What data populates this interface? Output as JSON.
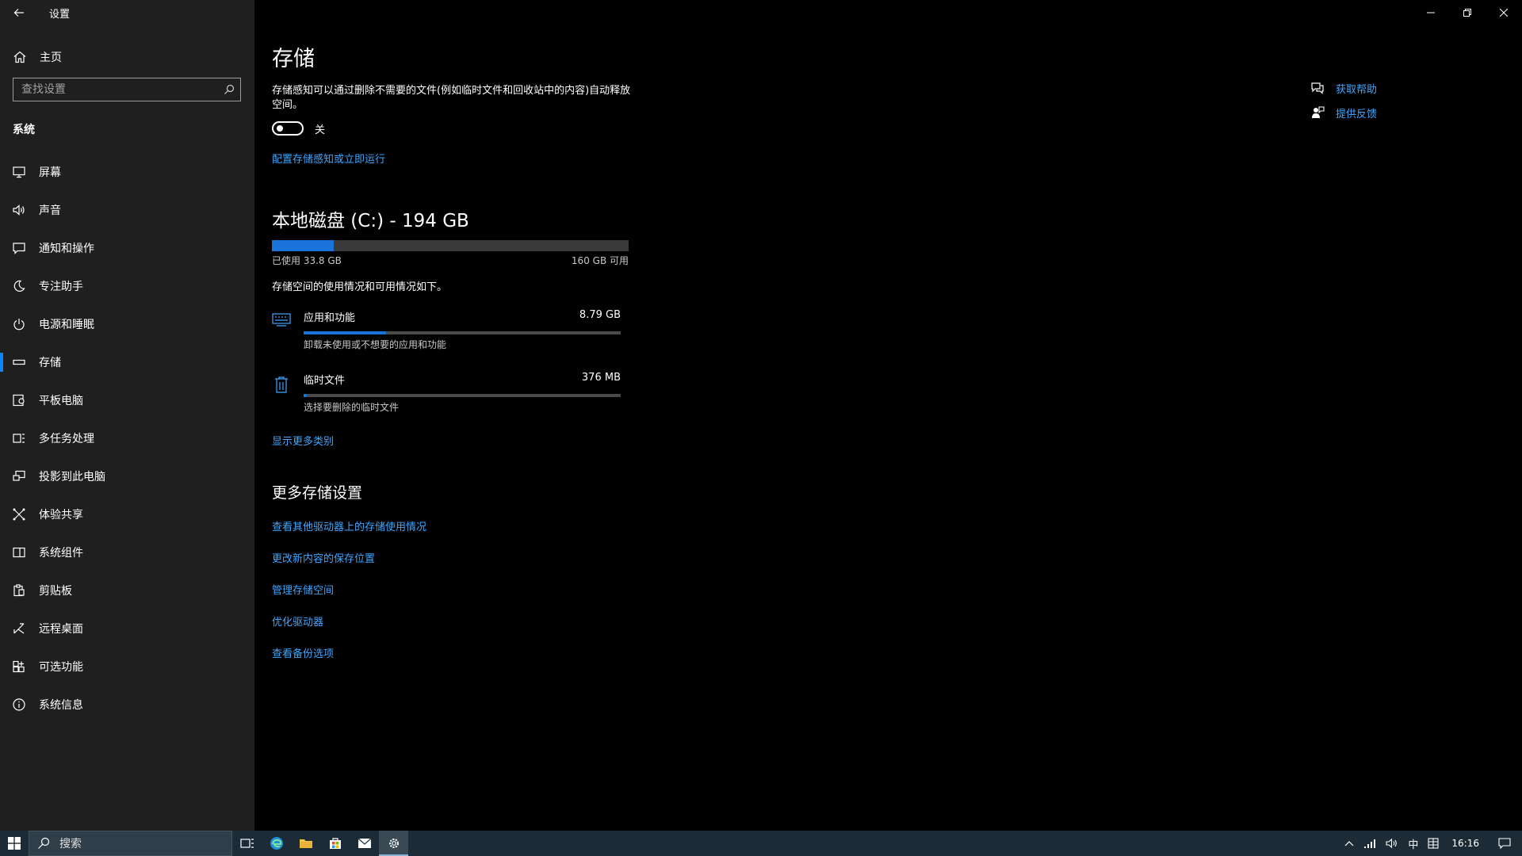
{
  "window": {
    "title": "设置"
  },
  "sidebar": {
    "home_label": "主页",
    "search_placeholder": "查找设置",
    "section_title": "系统",
    "items": [
      {
        "label": "屏幕",
        "icon": "monitor-icon"
      },
      {
        "label": "声音",
        "icon": "speaker-icon"
      },
      {
        "label": "通知和操作",
        "icon": "notification-icon"
      },
      {
        "label": "专注助手",
        "icon": "moon-icon"
      },
      {
        "label": "电源和睡眠",
        "icon": "power-icon"
      },
      {
        "label": "存储",
        "icon": "storage-icon",
        "active": true
      },
      {
        "label": "平板电脑",
        "icon": "tablet-icon"
      },
      {
        "label": "多任务处理",
        "icon": "multitask-icon"
      },
      {
        "label": "投影到此电脑",
        "icon": "project-icon"
      },
      {
        "label": "体验共享",
        "icon": "share-icon"
      },
      {
        "label": "系统组件",
        "icon": "components-icon"
      },
      {
        "label": "剪贴板",
        "icon": "clipboard-icon"
      },
      {
        "label": "远程桌面",
        "icon": "remote-icon"
      },
      {
        "label": "可选功能",
        "icon": "optional-features-icon"
      },
      {
        "label": "系统信息",
        "icon": "info-icon"
      }
    ]
  },
  "main": {
    "title": "存储",
    "description": "存储感知可以通过删除不需要的文件(例如临时文件和回收站中的内容)自动释放空间。",
    "toggle": {
      "state_label": "关",
      "on": false
    },
    "config_link": "配置存储感知或立即运行",
    "disk": {
      "title": "本地磁盘 (C:) - 194 GB",
      "used_label": "已使用 33.8 GB",
      "free_label": "160 GB 可用",
      "used_fraction": 0.174,
      "summary": "存储空间的使用情况和可用情况如下。"
    },
    "categories": [
      {
        "name": "应用和功能",
        "size": "8.79 GB",
        "subtitle": "卸载未使用或不想要的应用和功能",
        "fraction": 0.26,
        "icon": "keyboard-icon"
      },
      {
        "name": "临时文件",
        "size": "376 MB",
        "subtitle": "选择要删除的临时文件",
        "fraction": 0.011,
        "icon": "trash-icon"
      }
    ],
    "show_more": "显示更多类别",
    "more_settings_title": "更多存储设置",
    "more_links": [
      "查看其他驱动器上的存储使用情况",
      "更改新内容的保存位置",
      "管理存储空间",
      "优化驱动器",
      "查看备份选项"
    ]
  },
  "help": {
    "get_help": "获取帮助",
    "feedback": "提供反馈"
  },
  "taskbar": {
    "search_label": "搜索",
    "ime": "中",
    "time": "16:16"
  },
  "colors": {
    "accent": "#1a73d9",
    "link": "#3ea6ff",
    "sidebar_bg": "#1f1f1f"
  }
}
